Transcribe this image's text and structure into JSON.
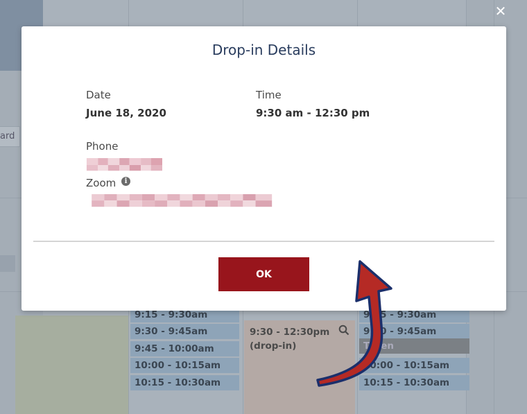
{
  "background": {
    "partial_tab_text": "ard",
    "col_left_slots": [
      "9:15 - 9:30am",
      "9:30 - 9:45am",
      "9:45 - 10:00am",
      "10:00 - 10:15am",
      "10:15 - 10:30am"
    ],
    "col_right_slots": [
      "9:15 - 9:30am",
      "9:30 - 9:45am",
      "Taken",
      "10:00 - 10:15am",
      "10:15 - 10:30am"
    ],
    "dropin_block": {
      "line1": "9:30 - 12:30pm",
      "line2": "(drop-in)",
      "icon": "search-icon"
    }
  },
  "close_icon": "close-icon",
  "modal": {
    "title": "Drop-in Details",
    "date_label": "Date",
    "date_value": "June 18, 2020",
    "time_label": "Time",
    "time_value": "9:30 am - 12:30 pm",
    "phone_label": "Phone",
    "zoom_label": "Zoom",
    "info_icon": "info-icon",
    "ok_label": "OK"
  },
  "annotation": {
    "arrow_icon": "arrow-icon",
    "arrow_fill": "#b52a25",
    "arrow_outline": "#1b2f6b"
  },
  "colors": {
    "accent": "#98151c",
    "title": "#2a3d5e",
    "overlay": "#a4adb6"
  }
}
